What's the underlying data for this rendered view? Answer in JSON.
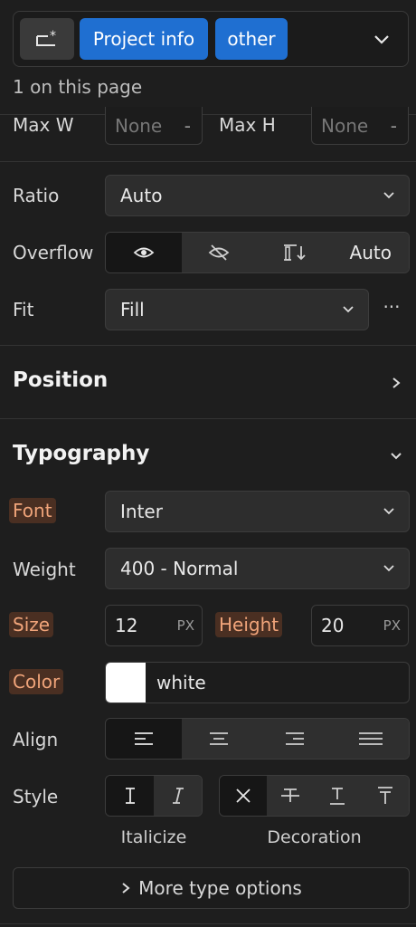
{
  "selector": {
    "chips": [
      "Project info",
      "other"
    ],
    "count_text": "1 on this page"
  },
  "size": {
    "max_w_label": "Max W",
    "max_w_value": "None",
    "max_h_label": "Max H",
    "max_h_value": "None",
    "dash": "-",
    "ratio_label": "Ratio",
    "ratio_value": "Auto",
    "overflow_label": "Overflow",
    "overflow_auto": "Auto",
    "fit_label": "Fit",
    "fit_value": "Fill",
    "more": "···"
  },
  "position": {
    "title": "Position"
  },
  "typography": {
    "title": "Typography",
    "font_label": "Font",
    "font_value": "Inter",
    "weight_label": "Weight",
    "weight_value": "400 - Normal",
    "size_label": "Size",
    "size_value": "12",
    "size_unit": "PX",
    "height_label": "Height",
    "height_value": "20",
    "height_unit": "PX",
    "color_label": "Color",
    "color_value": "white",
    "color_swatch": "#ffffff",
    "align_label": "Align",
    "style_label": "Style",
    "italicize_caption": "Italicize",
    "decoration_caption": "Decoration",
    "more_type_options": "More type options"
  },
  "colors": {
    "accent": "#1f6fd1",
    "highlight_bg": "#4a2f22",
    "highlight_text": "#f0a47a"
  }
}
